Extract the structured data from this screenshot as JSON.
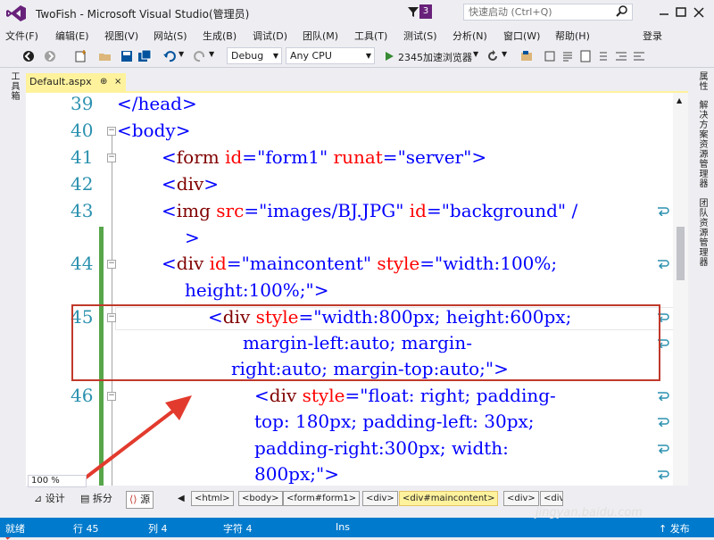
{
  "window": {
    "title": "TwoFish - Microsoft Visual Studio(管理员)",
    "notification_count": "3",
    "quicklaunch_placeholder": "快速启动 (Ctrl+Q)",
    "accent": "#68217A"
  },
  "menu": {
    "items": [
      "文件(F)",
      "编辑(E)",
      "视图(V)",
      "网站(S)",
      "生成(B)",
      "调试(D)",
      "团队(M)",
      "工具(T)",
      "测试(S)",
      "分析(N)",
      "窗口(W)",
      "帮助(H)"
    ],
    "login": "登录"
  },
  "toolbar": {
    "config": "Debug",
    "platform": "Any CPU",
    "browser": "2345加速浏览器"
  },
  "side_panels": {
    "left": "工具箱",
    "right": [
      "属性",
      "解决方案资源管理器",
      "团队资源管理器"
    ]
  },
  "document_tab": {
    "name": "Default.aspx",
    "pin": "⊕",
    "close": "×"
  },
  "editor": {
    "line_numbers": [
      "39",
      "40",
      "41",
      "42",
      "43",
      "44",
      "45",
      "46"
    ],
    "zoom": "100 %"
  },
  "code": {
    "l39": "</head>",
    "l40": "<body>",
    "l41": [
      "<",
      "form",
      " id",
      "=",
      "\"form1\"",
      " runat",
      "=",
      "\"server\"",
      ">"
    ],
    "l42": [
      "<",
      "div",
      ">"
    ],
    "l43": [
      "<",
      "img",
      " src",
      "=",
      "\"images/BJ.JPG\"",
      " id",
      "=",
      "\"background\"",
      " /"
    ],
    "l43b": ">",
    "l44": [
      "<",
      "div",
      " id",
      "=",
      "\"maincontent\"",
      " style",
      "=",
      "\"width:100%;"
    ],
    "l44b": "height:100%;\">",
    "l45a": [
      "<",
      "div",
      " style",
      "=",
      "\"width:800px; height:600px;"
    ],
    "l45b": "margin-left:auto; margin-",
    "l45c": "right:auto; margin-top:auto;\">",
    "l46a": [
      "<",
      "div",
      " style",
      "=",
      "\"float: right; padding-"
    ],
    "l46b": "top: 180px; padding-left: 30px;",
    "l46c": "padding-right:300px; width:",
    "l46d": "800px;\">"
  },
  "view_buttons": [
    "设计",
    "拆分",
    "源"
  ],
  "breadcrumbs": [
    "<html>",
    "<body>",
    "<form#form1>",
    "<div>",
    "<div#maincontent>",
    "<div>",
    "<div"
  ],
  "status": {
    "ready": "就绪",
    "line": "行 45",
    "col": "列 4",
    "char": "字符 4",
    "mode": "Ins",
    "publish": "↑ 发布"
  },
  "watermark": "jingyan.baidu.com"
}
